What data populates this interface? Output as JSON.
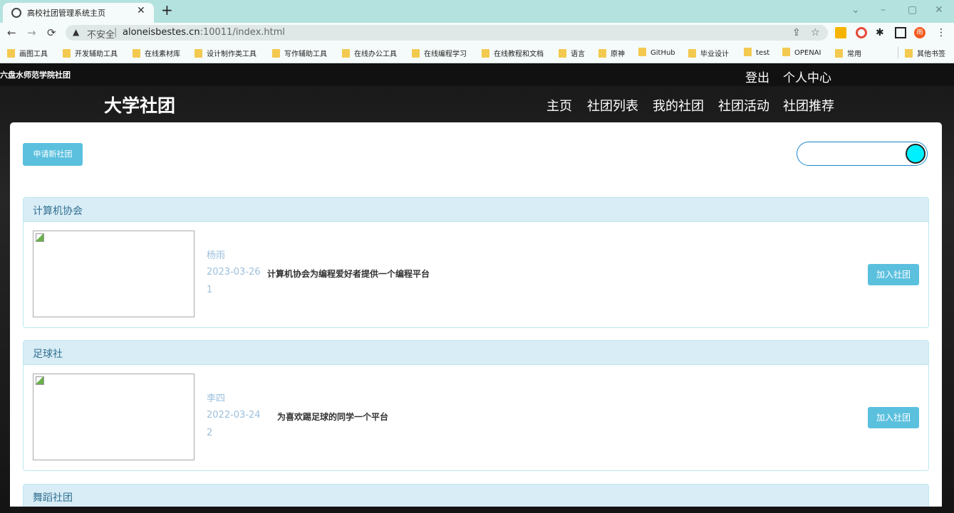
{
  "browser": {
    "tab_title": "高校社团管理系统主页",
    "url_security": "不安全",
    "url_separator": "|",
    "url_host": "aloneisbestes.cn",
    "url_path": ":10011/index.html",
    "profile_initial": "雨",
    "bookmarks": [
      "画图工具",
      "开发辅助工具",
      "在线素材库",
      "设计制作类工具",
      "写作辅助工具",
      "在线办公工具",
      "在线编程学习",
      "在线教程和文档",
      "语言",
      "原神",
      "GitHub",
      "毕业设计",
      "test",
      "OPENAI",
      "常用",
      "其他书签"
    ]
  },
  "site": {
    "school": "六盘水师范学院社团",
    "logout": "登出",
    "profile": "个人中心",
    "brand": "大学社团",
    "nav": [
      "主页",
      "社团列表",
      "我的社团",
      "社团活动",
      "社团推荐"
    ]
  },
  "actions": {
    "apply": "申请新社团",
    "join": "加入社团"
  },
  "clubs": [
    {
      "name": "计算机协会",
      "leader": "杨雨",
      "date": "2023-03-26",
      "desc": "计算机协会为编程爱好者提供一个编程平台",
      "count": "1"
    },
    {
      "name": "足球社",
      "leader": "李四",
      "date": "2022-03-24",
      "desc": "为喜欢踢足球的同学一个平台",
      "count": "2"
    },
    {
      "name": "舞蹈社团"
    }
  ]
}
